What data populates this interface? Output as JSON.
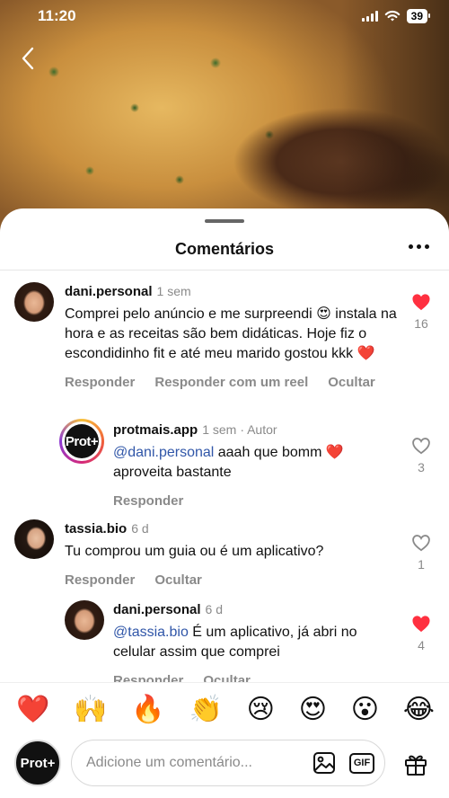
{
  "status_bar": {
    "time": "11:20",
    "battery": "39"
  },
  "sheet": {
    "title": "Comentários"
  },
  "comments": [
    {
      "username": "dani.personal",
      "time": "1 sem",
      "text": "Comprei pelo anúncio e me surpreendi 😍 instala na hora e as receitas são bem didáticas. Hoje fiz o escondidinho fit e até meu marido gostou kkk ❤️",
      "likes": "16",
      "liked": true,
      "actions": [
        "Responder",
        "Responder com um reel",
        "Ocultar"
      ]
    },
    {
      "username": "protmais.app",
      "time": "1 sem",
      "author_tag": "· Autor",
      "mention": "@dani.personal",
      "text": " aaah que bomm ❤️ aproveita bastante",
      "likes": "3",
      "liked": false,
      "actions": [
        "Responder"
      ],
      "avatar_text": "Prot+"
    },
    {
      "username": "tassia.bio",
      "time": "6 d",
      "text": "Tu comprou um guia ou é um aplicativo?",
      "likes": "1",
      "liked": false,
      "actions": [
        "Responder",
        "Ocultar"
      ]
    },
    {
      "username": "dani.personal",
      "time": "6 d",
      "mention": "@tassia.bio",
      "text": " É um aplicativo, já abri no celular assim que comprei",
      "likes": "4",
      "liked": true,
      "actions": [
        "Responder",
        "Ocultar"
      ]
    }
  ],
  "emoji_bar": [
    "❤️",
    "🙌",
    "🔥",
    "👏",
    "😢",
    "😍",
    "😮",
    "😂"
  ],
  "composer": {
    "avatar_text": "Prot+",
    "placeholder": "Adicione um comentário...",
    "gif_label": "GIF"
  },
  "colors": {
    "like_red": "#ff3040",
    "mention_blue": "#3056a8",
    "muted_gray": "#8a8a8a"
  }
}
